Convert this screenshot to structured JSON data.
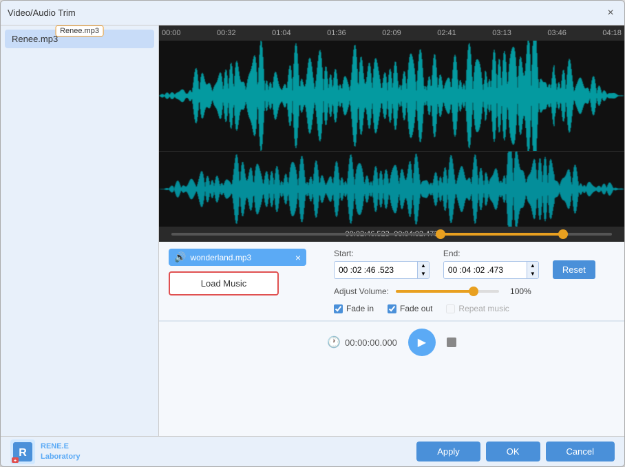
{
  "window": {
    "title": "Video/Audio Trim",
    "close_btn": "×"
  },
  "sidebar": {
    "items": [
      {
        "id": "renee-mp3",
        "label": "Renee.mp3",
        "active": true,
        "tag": "Renee.mp3"
      }
    ]
  },
  "timeline": {
    "labels": [
      "00:00",
      "00:32",
      "01:04",
      "01:36",
      "02:09",
      "02:41",
      "03:13",
      "03:46",
      "04:18"
    ]
  },
  "trim_range": {
    "info": "00:02:46.523~00:04:02.473"
  },
  "music_file": {
    "name": "wonderland.mp3",
    "close_label": "×"
  },
  "load_music_btn": "Load Music",
  "trim_settings": {
    "start_label": "Start:",
    "end_label": "End:",
    "start_value": "00 :02 :46 .523",
    "end_value": "00 :04 :02 .473",
    "reset_label": "Reset",
    "volume_label": "Adjust Volume:",
    "volume_pct": "100%",
    "fade_in_label": "Fade in",
    "fade_out_label": "Fade out",
    "repeat_music_label": "Repeat music"
  },
  "playback": {
    "time": "00:00:00.000",
    "play_icon": "▶",
    "stop_color": "#888"
  },
  "footer": {
    "logo_line1": "RENE.E",
    "logo_line2": "Laboratory",
    "apply_label": "Apply",
    "ok_label": "OK",
    "cancel_label": "Cancel"
  }
}
